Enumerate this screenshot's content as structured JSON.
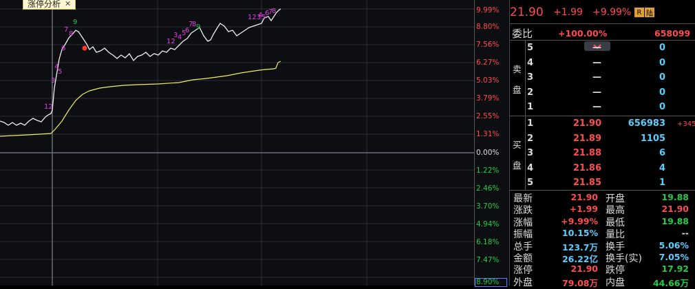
{
  "tab": {
    "label": "涨停分析",
    "close": "✕"
  },
  "axis_percent": [
    {
      "label": "9.99%",
      "color": "#ff4d4d"
    },
    {
      "label": "8.80%",
      "color": "#ff4d4d"
    },
    {
      "label": "7.56%",
      "color": "#ff4d4d"
    },
    {
      "label": "6.27%",
      "color": "#ff4d4d"
    },
    {
      "label": "5.03%",
      "color": "#ff4d4d"
    },
    {
      "label": "3.79%",
      "color": "#ff4d4d"
    },
    {
      "label": "2.55%",
      "color": "#ff4d4d"
    },
    {
      "label": "1.31%",
      "color": "#ff4d4d"
    },
    {
      "label": "0.00%",
      "color": "#dddddd"
    },
    {
      "label": "1.22%",
      "color": "#22cc44"
    },
    {
      "label": "2.46%",
      "color": "#22cc44"
    },
    {
      "label": "3.70%",
      "color": "#22cc44"
    },
    {
      "label": "4.94%",
      "color": "#22cc44"
    },
    {
      "label": "6.18%",
      "color": "#22cc44"
    },
    {
      "label": "7.47%",
      "color": "#22cc44"
    },
    {
      "label": "8.90%",
      "color": "#22cc44"
    }
  ],
  "chart_marks": [
    {
      "t": "12",
      "c": "#e040e0"
    },
    {
      "t": "3",
      "c": "#e040e0"
    },
    {
      "t": "4",
      "c": "#e040e0"
    },
    {
      "t": "5",
      "c": "#e040e0"
    },
    {
      "t": "6",
      "c": "#e040e0"
    },
    {
      "t": "7",
      "c": "#e040e0"
    },
    {
      "t": "8",
      "c": "#e040e0"
    },
    {
      "t": "9",
      "c": "#22cc44"
    },
    {
      "t": "12",
      "c": "#e040e0"
    },
    {
      "t": "3",
      "c": "#e040e0"
    },
    {
      "t": "4",
      "c": "#e040e0"
    },
    {
      "t": "5",
      "c": "#e040e0"
    },
    {
      "t": "6",
      "c": "#e040e0"
    },
    {
      "t": "7",
      "c": "#e040e0"
    },
    {
      "t": "8",
      "c": "#e040e0"
    },
    {
      "t": "9",
      "c": "#22cc44"
    },
    {
      "t": "123",
      "c": "#e040e0"
    },
    {
      "t": "4",
      "c": "#e040e0"
    },
    {
      "t": "5",
      "c": "#e040e0"
    },
    {
      "t": "6",
      "c": "#e040e0"
    },
    {
      "t": "7",
      "c": "#e040e0"
    },
    {
      "t": "8",
      "c": "#e040e0"
    }
  ],
  "quote": {
    "price": "21.90",
    "change": "+1.99",
    "pct": "+9.99%",
    "badge_r": "R",
    "badge_lu": "陆",
    "colors": {
      "up": "#ff4d4d",
      "down": "#22cc44",
      "vol": "#5ad0ff",
      "neutral": "#dddddd"
    }
  },
  "weibi": {
    "label": "委比",
    "pct": "+100.00%",
    "diff": "658099"
  },
  "sell": {
    "side_label_1": "卖",
    "side_label_2": "盘",
    "rows": [
      {
        "lvl": "5",
        "price": "—",
        "vol": "0"
      },
      {
        "lvl": "4",
        "price": "—",
        "vol": "0"
      },
      {
        "lvl": "3",
        "price": "—",
        "vol": "0"
      },
      {
        "lvl": "2",
        "price": "—",
        "vol": "0"
      },
      {
        "lvl": "1",
        "price": "—",
        "vol": "0"
      }
    ]
  },
  "buy": {
    "side_label_1": "买",
    "side_label_2": "盘",
    "rows": [
      {
        "lvl": "1",
        "price": "21.90",
        "vol": "656983",
        "delta": "+345"
      },
      {
        "lvl": "2",
        "price": "21.89",
        "vol": "1105",
        "delta": ""
      },
      {
        "lvl": "3",
        "price": "21.88",
        "vol": "6",
        "delta": ""
      },
      {
        "lvl": "4",
        "price": "21.86",
        "vol": "4",
        "delta": ""
      },
      {
        "lvl": "5",
        "price": "21.85",
        "vol": "1",
        "delta": ""
      }
    ]
  },
  "stats": [
    {
      "l1": "最新",
      "v1": "21.90",
      "c1": "#ff4d4d",
      "l2": "开盘",
      "v2": "19.88",
      "c2": "#22cc44"
    },
    {
      "l1": "涨跌",
      "v1": "+1.99",
      "c1": "#ff4d4d",
      "l2": "最高",
      "v2": "21.90",
      "c2": "#ff4d4d"
    },
    {
      "l1": "涨幅",
      "v1": "+9.99%",
      "c1": "#ff4d4d",
      "l2": "最低",
      "v2": "19.88",
      "c2": "#22cc44"
    },
    {
      "l1": "振幅",
      "v1": "10.15%",
      "c1": "#5ad0ff",
      "l2": "量比",
      "v2": "--",
      "c2": "#dddddd"
    },
    {
      "l1": "总手",
      "v1": "123.7万",
      "c1": "#5ad0ff",
      "l2": "换手",
      "v2": "5.06%",
      "c2": "#5ad0ff"
    },
    {
      "l1": "金额",
      "v1": "26.22亿",
      "c1": "#5ad0ff",
      "l2": "换手(实)",
      "v2": "7.05%",
      "c2": "#5ad0ff"
    },
    {
      "l1": "涨停",
      "v1": "21.90",
      "c1": "#ff4d4d",
      "l2": "跌停",
      "v2": "17.92",
      "c2": "#22cc44"
    },
    {
      "l1": "外盘",
      "v1": "79.08万",
      "c1": "#ff4d4d",
      "l2": "内盘",
      "v2": "44.66万",
      "c2": "#22cc44"
    }
  ]
}
